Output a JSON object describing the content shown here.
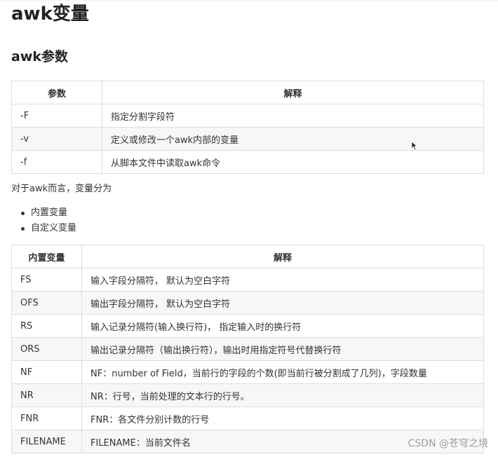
{
  "heading": "awk变量",
  "subheading": "awk参数",
  "params_table": {
    "headers": [
      "参数",
      "解释"
    ],
    "rows": [
      [
        "-F",
        "指定分割字段符"
      ],
      [
        "-v",
        "定义或修改一个awk内部的变量"
      ],
      [
        "-f",
        "从脚本文件中读取awk命令"
      ]
    ]
  },
  "intro_text": "对于awk而言，变量分为",
  "bullets": [
    "内置变量",
    "自定义变量"
  ],
  "builtin_table": {
    "headers": [
      "内置变量",
      "解释"
    ],
    "rows": [
      [
        "FS",
        "输入字段分隔符，  默认为空白字符"
      ],
      [
        "OFS",
        "输出字段分隔符，  默认为空白字符"
      ],
      [
        "RS",
        "输入记录分隔符(输入换行符)，  指定输入时的换行符"
      ],
      [
        "ORS",
        "输出记录分隔符（输出换行符），输出时用指定符号代替换行符"
      ],
      [
        "NF",
        "NF：number of Field，当前行的字段的个数(即当前行被分割成了几列)，字段数量"
      ],
      [
        "NR",
        "NR：行号，当前处理的文本行的行号。"
      ],
      [
        "FNR",
        "FNR：各文件分别计数的行号"
      ],
      [
        "FILENAME",
        "FILENAME：当前文件名"
      ]
    ]
  },
  "watermark": "CSDN @苍穹之境",
  "icons": {
    "cursor": "mouse-pointer-icon"
  }
}
